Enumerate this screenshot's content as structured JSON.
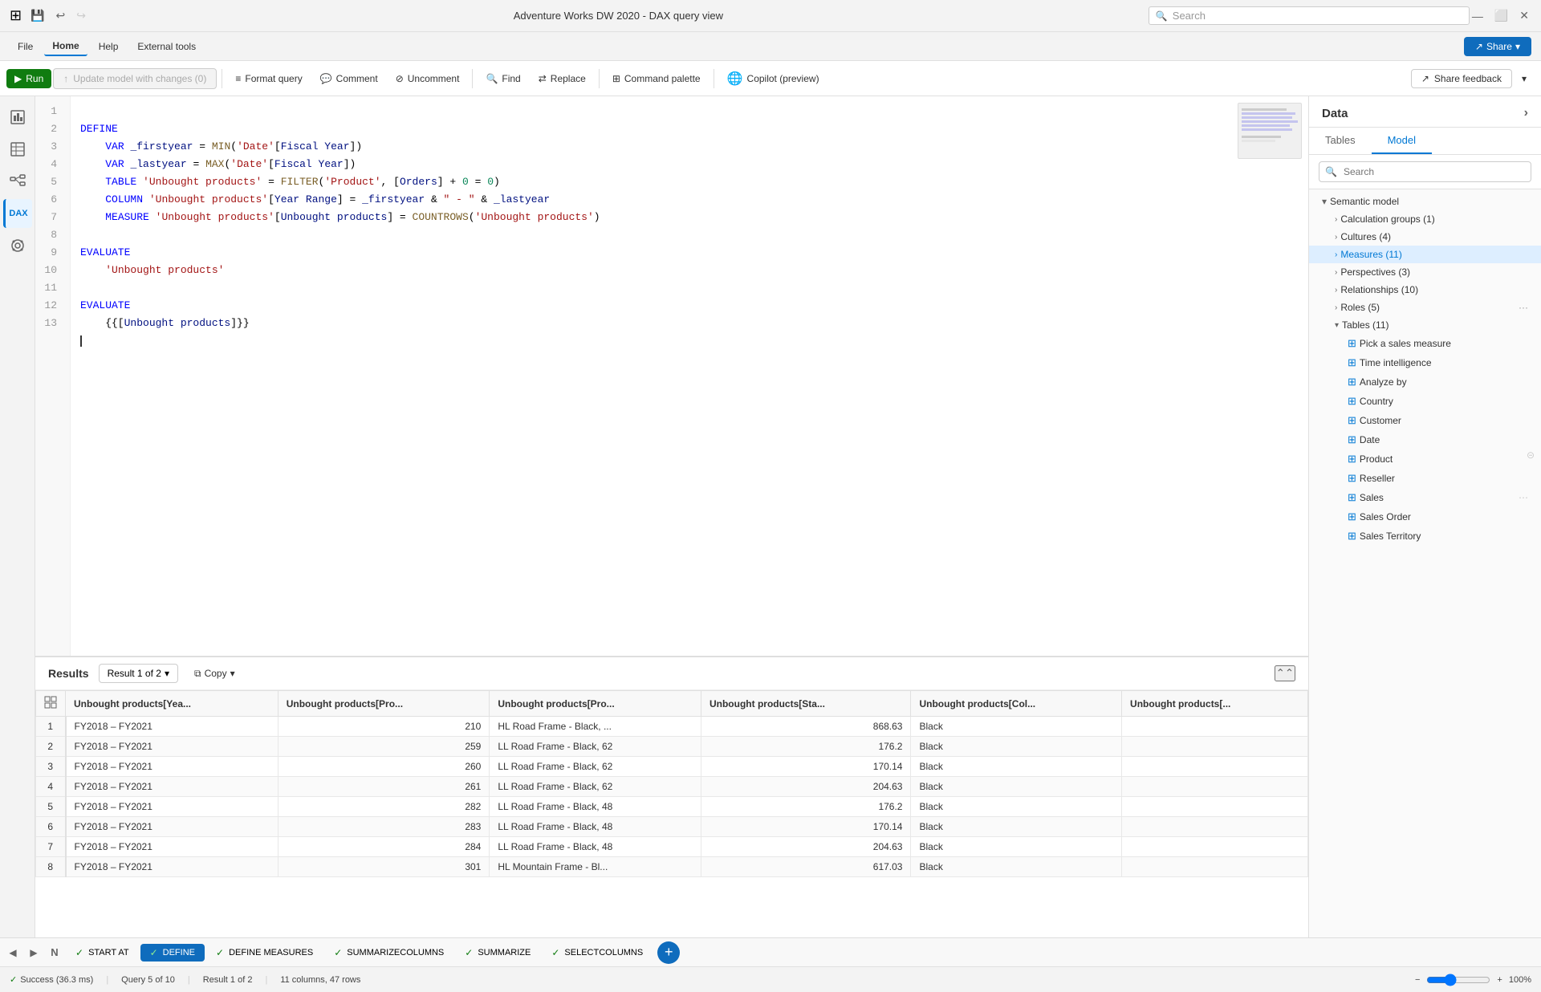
{
  "titleBar": {
    "title": "Adventure Works DW 2020 - DAX query view",
    "searchPlaceholder": "Search",
    "saveIcon": "💾",
    "undoIcon": "↩",
    "redoIcon": "↪"
  },
  "menuBar": {
    "items": [
      "File",
      "Home",
      "Help",
      "External tools"
    ],
    "activeItem": "Home",
    "shareLabel": "Share"
  },
  "toolbar": {
    "runLabel": "Run",
    "updateModelLabel": "Update model with changes (0)",
    "formatQueryLabel": "Format query",
    "commentLabel": "Comment",
    "uncommentLabel": "Uncomment",
    "findLabel": "Find",
    "replaceLabel": "Replace",
    "commandPaletteLabel": "Command palette",
    "copilotLabel": "Copilot (preview)",
    "shareFeedbackLabel": "Share feedback"
  },
  "codeEditor": {
    "lines": [
      {
        "num": 1,
        "content": "DEFINE"
      },
      {
        "num": 2,
        "content": "    VAR _firstyear = MIN('Date'[Fiscal Year])"
      },
      {
        "num": 3,
        "content": "    VAR _lastyear = MAX('Date'[Fiscal Year])"
      },
      {
        "num": 4,
        "content": "    TABLE 'Unbought products' = FILTER('Product', [Orders] + 0 = 0)"
      },
      {
        "num": 5,
        "content": "    COLUMN 'Unbought products'[Year Range] = _firstyear & \" - \" & _lastyear"
      },
      {
        "num": 6,
        "content": "    MEASURE 'Unbought products'[Unbought products] = COUNTROWS('Unbought products')"
      },
      {
        "num": 7,
        "content": ""
      },
      {
        "num": 8,
        "content": "EVALUATE"
      },
      {
        "num": 9,
        "content": "    'Unbought products'"
      },
      {
        "num": 10,
        "content": ""
      },
      {
        "num": 11,
        "content": "EVALUATE"
      },
      {
        "num": 12,
        "content": "    {{[Unbought products]}}"
      },
      {
        "num": 13,
        "content": ""
      }
    ]
  },
  "results": {
    "title": "Results",
    "resultSelector": "Result 1 of 2",
    "copyLabel": "Copy",
    "columns": [
      "Unbought products[Yea...",
      "Unbought products[Pro...",
      "Unbought products[Pro...",
      "Unbought products[Sta...",
      "Unbought products[Col...",
      "Unbought products[..."
    ],
    "rows": [
      {
        "num": 1,
        "col1": "FY2018 – FY2021",
        "col2": "210",
        "col3": "HL Road Frame - Black, ...",
        "col4": "868.63",
        "col5": "Black",
        "col6": ""
      },
      {
        "num": 2,
        "col1": "FY2018 – FY2021",
        "col2": "259",
        "col3": "LL Road Frame - Black, 62",
        "col4": "176.2",
        "col5": "Black",
        "col6": ""
      },
      {
        "num": 3,
        "col1": "FY2018 – FY2021",
        "col2": "260",
        "col3": "LL Road Frame - Black, 62",
        "col4": "170.14",
        "col5": "Black",
        "col6": ""
      },
      {
        "num": 4,
        "col1": "FY2018 – FY2021",
        "col2": "261",
        "col3": "LL Road Frame - Black, 62",
        "col4": "204.63",
        "col5": "Black",
        "col6": ""
      },
      {
        "num": 5,
        "col1": "FY2018 – FY2021",
        "col2": "282",
        "col3": "LL Road Frame - Black, 48",
        "col4": "176.2",
        "col5": "Black",
        "col6": ""
      },
      {
        "num": 6,
        "col1": "FY2018 – FY2021",
        "col2": "283",
        "col3": "LL Road Frame - Black, 48",
        "col4": "170.14",
        "col5": "Black",
        "col6": ""
      },
      {
        "num": 7,
        "col1": "FY2018 – FY2021",
        "col2": "284",
        "col3": "LL Road Frame - Black, 48",
        "col4": "204.63",
        "col5": "Black",
        "col6": ""
      },
      {
        "num": 8,
        "col1": "FY2018 – FY2021",
        "col2": "301",
        "col3": "HL Mountain Frame - Bl...",
        "col4": "617.03",
        "col5": "Black",
        "col6": ""
      }
    ]
  },
  "rightPanel": {
    "title": "Data",
    "expandIcon": "›",
    "tabs": [
      "Tables",
      "Model"
    ],
    "activeTab": "Model",
    "searchPlaceholder": "Search",
    "tree": {
      "semanticModel": "Semantic model",
      "items": [
        {
          "label": "Calculation groups (1)",
          "indent": 1
        },
        {
          "label": "Cultures (4)",
          "indent": 1
        },
        {
          "label": "Measures (11)",
          "indent": 1,
          "active": true
        },
        {
          "label": "Perspectives (3)",
          "indent": 1
        },
        {
          "label": "Relationships (10)",
          "indent": 1
        },
        {
          "label": "Roles (5)",
          "indent": 1
        },
        {
          "label": "Tables (11)",
          "indent": 1,
          "expanded": true
        },
        {
          "label": "Pick a sales measure",
          "indent": 2,
          "icon": "table"
        },
        {
          "label": "Time intelligence",
          "indent": 2,
          "icon": "table"
        },
        {
          "label": "Analyze by",
          "indent": 2,
          "icon": "table"
        },
        {
          "label": "Country",
          "indent": 2,
          "icon": "table"
        },
        {
          "label": "Customer",
          "indent": 2,
          "icon": "table"
        },
        {
          "label": "Date",
          "indent": 2,
          "icon": "table"
        },
        {
          "label": "Product",
          "indent": 2,
          "icon": "table"
        },
        {
          "label": "Reseller",
          "indent": 2,
          "icon": "table"
        },
        {
          "label": "Sales",
          "indent": 2,
          "icon": "table"
        },
        {
          "label": "Sales Order",
          "indent": 2,
          "icon": "table"
        },
        {
          "label": "Sales Territory",
          "indent": 2,
          "icon": "table"
        }
      ]
    }
  },
  "statusBar": {
    "successIcon": "✓",
    "successLabel": "Success (36.3 ms)",
    "queryLabel": "Query 5 of 10",
    "resultLabel": "Result 1 of 2",
    "columnsRows": "11 columns, 47 rows",
    "zoomLabel": "100%"
  },
  "tabBar": {
    "tabs": [
      {
        "label": "START AT",
        "active": false,
        "hasCheck": true
      },
      {
        "label": "DEFINE",
        "active": true,
        "hasCheck": true
      },
      {
        "label": "DEFINE MEASURES",
        "active": false,
        "hasCheck": true
      },
      {
        "label": "SUMMARIZECOLUMNS",
        "active": false,
        "hasCheck": true
      },
      {
        "label": "SUMMARIZE",
        "active": false,
        "hasCheck": true
      },
      {
        "label": "SELECTCOLUMNS",
        "active": false,
        "hasCheck": true
      }
    ],
    "addLabel": "+"
  }
}
